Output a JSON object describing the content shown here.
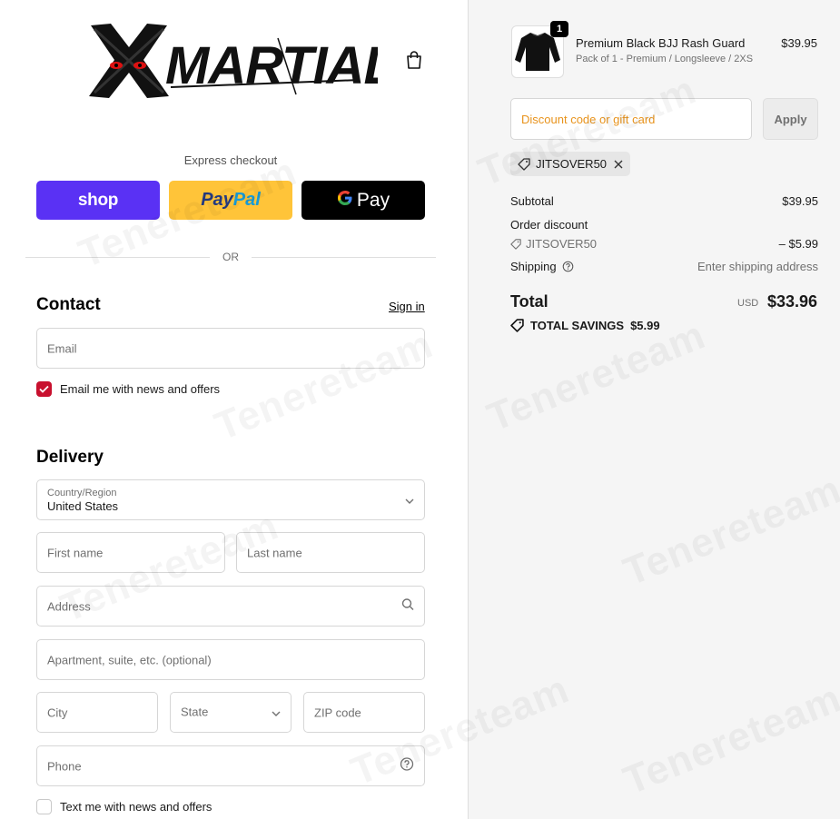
{
  "brand": {
    "logo_text": "MARTIAL"
  },
  "express": {
    "label": "Express checkout",
    "shop_label": "shop",
    "paypal_a": "Pay",
    "paypal_b": "Pal",
    "gpay_g": "G",
    "gpay_label": "Pay"
  },
  "divider": {
    "or": "OR"
  },
  "contact": {
    "title": "Contact",
    "sign_in": "Sign in",
    "email_placeholder": "Email",
    "news_label": "Email me with news and offers",
    "news_checked": true
  },
  "delivery": {
    "title": "Delivery",
    "country_label": "Country/Region",
    "country_value": "United States",
    "first_name": "First name",
    "last_name": "Last name",
    "address": "Address",
    "apartment": "Apartment, suite, etc. (optional)",
    "city": "City",
    "state": "State",
    "zip": "ZIP code",
    "phone": "Phone",
    "text_label": "Text me with news and offers",
    "text_checked": false
  },
  "order": {
    "item": {
      "quantity": "1",
      "title": "Premium Black BJJ Rash Guard",
      "variant": "Pack of 1 - Premium / Longsleeve / 2XS",
      "price": "$39.95"
    },
    "discount_placeholder": "Discount code or gift card",
    "apply_label": "Apply",
    "applied_code": "JITSOVER50",
    "subtotal_label": "Subtotal",
    "subtotal_value": "$39.95",
    "order_discount_label": "Order discount",
    "order_discount_code": "JITSOVER50",
    "order_discount_value": "– $5.99",
    "shipping_label": "Shipping",
    "shipping_value": "Enter shipping address",
    "total_label": "Total",
    "currency": "USD",
    "total_value": "$33.96",
    "savings_label": "TOTAL SAVINGS",
    "savings_value": "$5.99"
  },
  "watermark": "Tenereteam",
  "colors": {
    "shop": "#5a31f4",
    "paypal": "#ffc439",
    "gpay": "#000000",
    "checkbox": "#c8102e",
    "discount_placeholder": "#e8931c"
  }
}
